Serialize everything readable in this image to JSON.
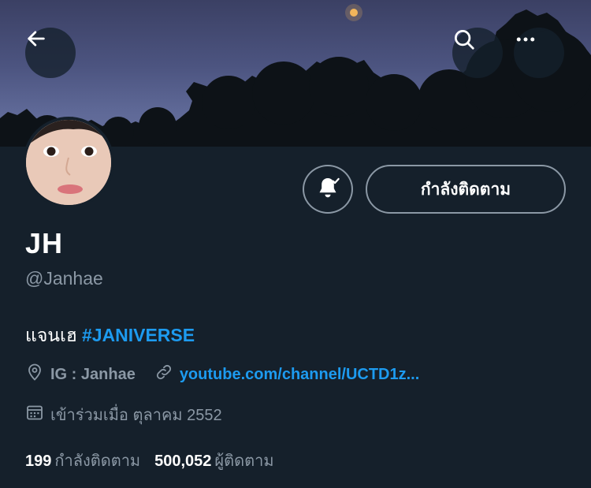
{
  "banner": {
    "sky_color": "#4c5480",
    "tree_color": "#0f1419",
    "moon_color": "#f2b55a"
  },
  "toolbar": {
    "back_icon": "arrow-left-icon",
    "search_icon": "search-icon",
    "more_icon": "more-horizontal-icon"
  },
  "profile": {
    "display_name": "JH",
    "handle": "@Janhae",
    "bio_text": "แจนเฮ",
    "bio_hashtag": "#JANIVERSE",
    "location": "IG : Janhae",
    "website": "youtube.com/channel/UCTD1z...",
    "joined": "เข้าร่วมเมื่อ ตุลาคม 2552"
  },
  "actions": {
    "follow_label": "กำลังติดตาม",
    "bell_icon": "bell-subscribed-icon"
  },
  "stats": {
    "following_count": "199",
    "following_label": "กำลังติดตาม",
    "followers_count": "500,052",
    "followers_label": "ผู้ติดตาม"
  },
  "colors": {
    "background": "#15202b",
    "accent": "#1d9bf0",
    "secondary_text": "#8b98a5",
    "border": "#8b98a5"
  }
}
